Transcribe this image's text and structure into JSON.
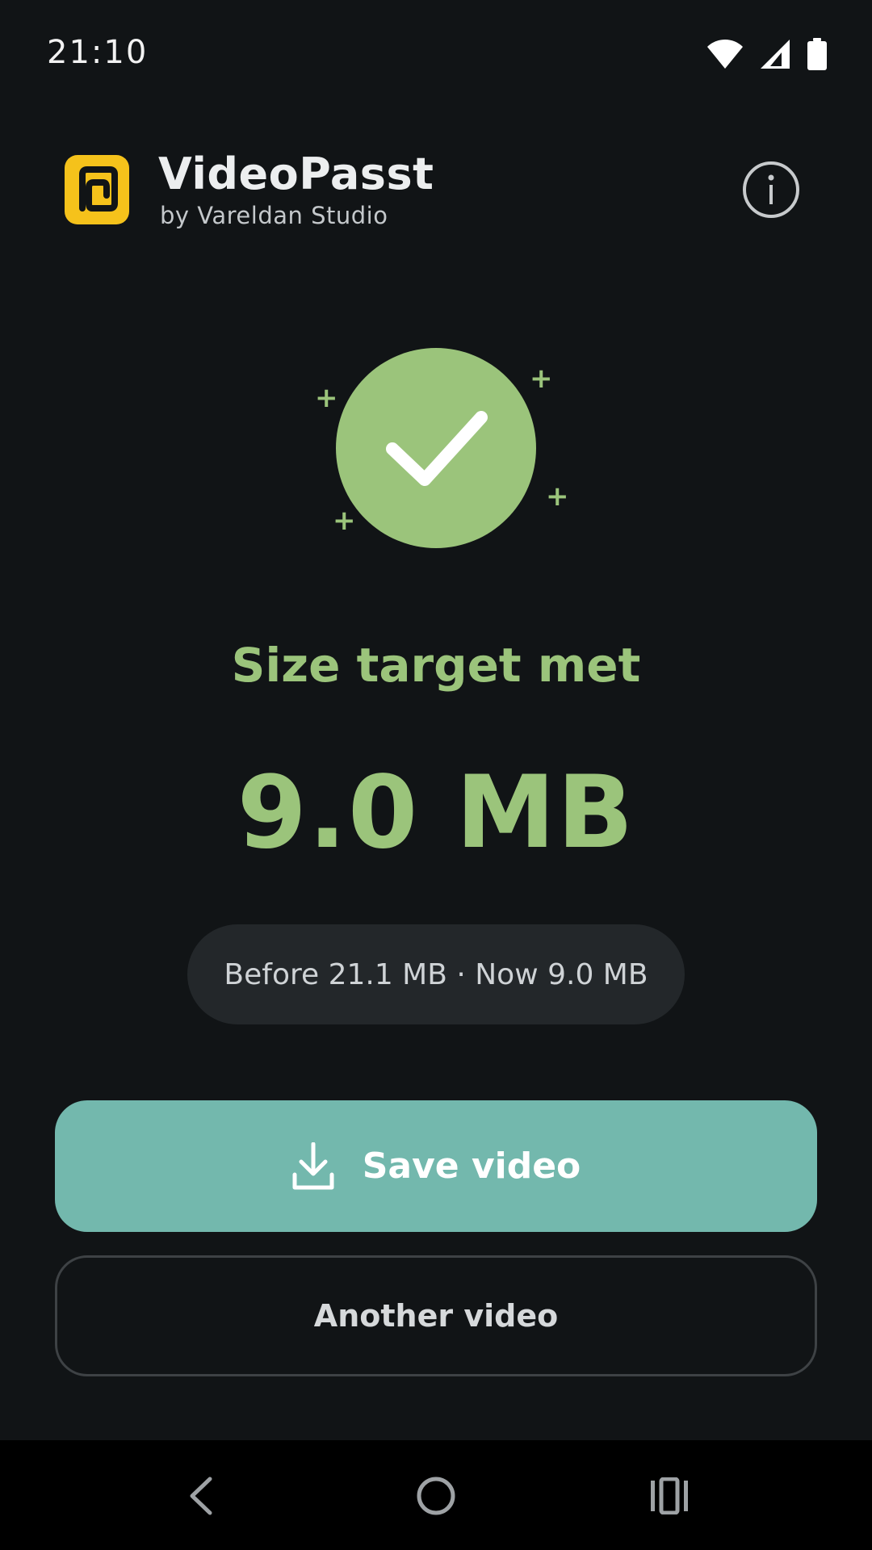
{
  "status_bar": {
    "time": "21:10",
    "icons": [
      "wifi-icon",
      "signal-icon",
      "battery-icon"
    ]
  },
  "app": {
    "title": "VideoPasst",
    "subtitle": "by Vareldan Studio",
    "logo_color": "#f5c21b"
  },
  "result": {
    "headline": "Size target met",
    "size": "9.0 MB",
    "comparison": "Before 21.1 MB · Now 9.0 MB",
    "accent_color": "#9bc47b"
  },
  "actions": {
    "save_label": "Save video",
    "another_label": "Another video",
    "save_color": "#73b8ad"
  },
  "nav": {
    "icons": [
      "back-icon",
      "home-icon",
      "recents-icon"
    ]
  }
}
